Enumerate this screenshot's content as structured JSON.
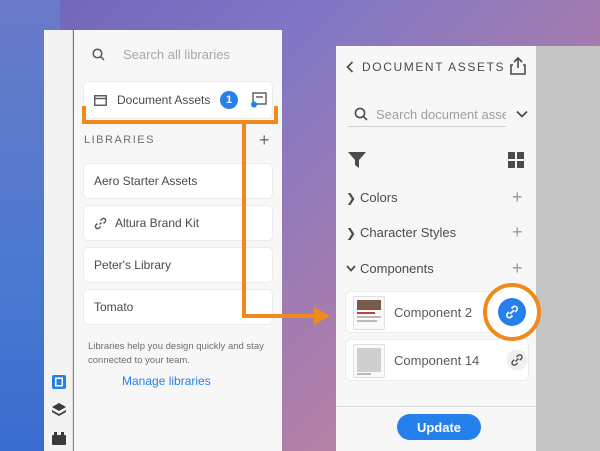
{
  "left_panel": {
    "search_placeholder": "Search all libraries",
    "document_assets": {
      "label": "Document Assets",
      "badge": "1"
    },
    "libraries_header": "LIBRARIES",
    "libraries": [
      {
        "label": "Aero Starter Assets",
        "icon": "none"
      },
      {
        "label": "Altura Brand Kit",
        "icon": "link-icon"
      },
      {
        "label": "Peter's Library",
        "icon": "none"
      },
      {
        "label": "Tomato",
        "icon": "none"
      }
    ],
    "helper_text": "Libraries help you design quickly and stay connected to your team.",
    "manage_link": "Manage libraries"
  },
  "right_panel": {
    "title": "DOCUMENT ASSETS",
    "search_placeholder": "Search document assets",
    "sections": [
      {
        "label": "Colors",
        "expanded": false
      },
      {
        "label": "Character Styles",
        "expanded": false
      },
      {
        "label": "Components",
        "expanded": true
      }
    ],
    "components": [
      {
        "name": "Component 2",
        "linked_highlighted": true
      },
      {
        "name": "Component 14",
        "linked_highlighted": false
      }
    ],
    "update_label": "Update"
  },
  "colors": {
    "accent": "#2680eb",
    "callout": "#f08a1c"
  }
}
